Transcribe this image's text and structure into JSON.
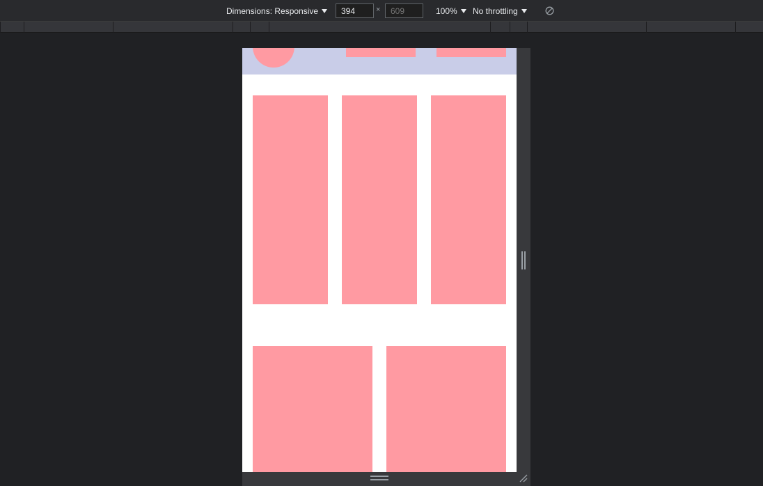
{
  "toolbar": {
    "dimensions_label": "Dimensions: Responsive",
    "width_value": "394",
    "height_placeholder": "609",
    "times_symbol": "×",
    "zoom_label": "100%",
    "throttling_label": "No throttling",
    "rotate_icon": "rotate-disabled-icon"
  },
  "colors": {
    "header_bg": "#c9cde8",
    "card": "#ff9aa2",
    "viewport_bg": "#ffffff",
    "app_bg": "#202124"
  },
  "page": {
    "header": {
      "logo_icon": "circle-logo",
      "nav_items": 2
    },
    "row_one_cards": 3,
    "row_two_cards": 2
  }
}
